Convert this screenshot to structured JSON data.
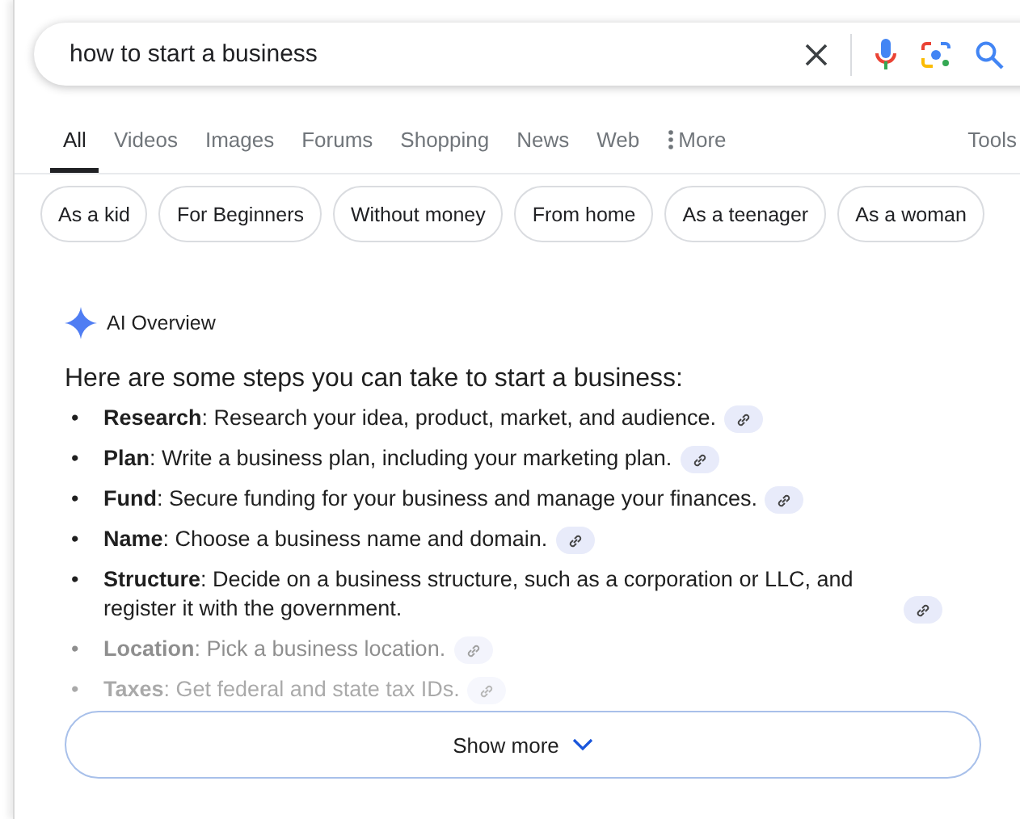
{
  "search": {
    "value": "how to start a business"
  },
  "tabs": [
    {
      "label": "All",
      "selected": true
    },
    {
      "label": "Videos",
      "selected": false
    },
    {
      "label": "Images",
      "selected": false
    },
    {
      "label": "Forums",
      "selected": false
    },
    {
      "label": "Shopping",
      "selected": false
    },
    {
      "label": "News",
      "selected": false
    },
    {
      "label": "Web",
      "selected": false
    }
  ],
  "more_label": "More",
  "tools_label": "Tools",
  "chips": [
    "As a kid",
    "For Beginners",
    "Without money",
    "From home",
    "As a teenager",
    "As a woman"
  ],
  "ai_overview": {
    "title": "AI Overview",
    "heading": "Here are some steps you can take to start a business:",
    "steps": [
      {
        "marker": "•",
        "text": "**Research**: Research your idea, product, market, and audience.",
        "kind": "full"
      },
      {
        "marker": "•",
        "text": "**Plan**: Write a business plan, including your marketing plan.",
        "kind": "full"
      },
      {
        "marker": "•",
        "text": "**Fund**: Secure funding for your business and manage your finances.",
        "kind": "full"
      },
      {
        "marker": "•",
        "text": "**Name**: Choose a business name and domain.",
        "kind": "full"
      },
      {
        "marker": "•",
        "text": "**Structure**: Decide on a business structure, such as a corporation or LLC, and register it with the government.",
        "kind": "full"
      },
      {
        "marker": "•",
        "text": "**Location**: Pick a business location.",
        "kind": "fading"
      },
      {
        "marker": "•",
        "text": "**Taxes**: Get federal and state tax IDs.",
        "kind": "faint"
      }
    ],
    "show_more": "Show more"
  }
}
